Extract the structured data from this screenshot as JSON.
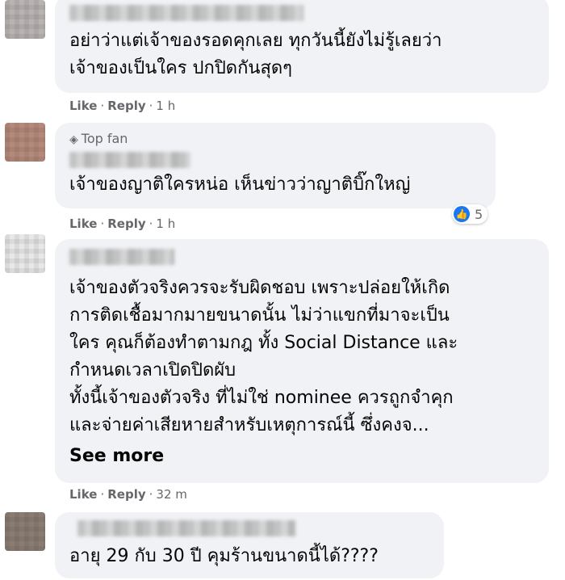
{
  "comments": [
    {
      "lines": [
        "อย่าว่าแต่เจ้าของรอดคุกเลย ทุกวันนี้ยังไม่รู้เลยว่า",
        "เจ้าของเป็นใคร ปกปิดกันสุดๆ"
      ],
      "like": "Like",
      "reply": "Reply",
      "sep": "·",
      "time": "1 h"
    },
    {
      "badge": "Top fan",
      "lines": [
        "เจ้าของญาติใครหน่อ เห็นข่าวว่าญาติบิ๊กใหญ่"
      ],
      "like": "Like",
      "reply": "Reply",
      "sep": "·",
      "time": "1 h",
      "reaction_count": "5"
    },
    {
      "lines": [
        "เจ้าของตัวจริงควรจะรับผิดชอบ เพราะปล่อยให้เกิด",
        "การติดเชื้อมากมายขนาดนั้น ไม่ว่าแขกที่มาจะเป็น",
        "ใคร คุณก็ต้องทำตามกฎ ทั้ง Social Distance และ",
        "กำหนดเวลาเปิดปิดผับ",
        "ทั้งนี้เจ้าของตัวจริง ที่ไม่ใช่ nominee ควรถูกจำคุก",
        "และจ่ายค่าเสียหายสำหรับเหตุการณ์นี้ ซึ่งคงจ..."
      ],
      "see_more": "See more",
      "like": "Like",
      "reply": "Reply",
      "sep": "·",
      "time": "32 m"
    },
    {
      "lines": [
        "อายุ 29 กับ 30 ปี คุมร้านขนาดนี้ได้????"
      ]
    }
  ],
  "icons": {
    "badge": "diamond-icon",
    "reaction": "thumbs-up-icon"
  },
  "colors": {
    "bubble": "#f0f2f5",
    "meta": "#65676b",
    "like_blue": "#1877f2"
  }
}
